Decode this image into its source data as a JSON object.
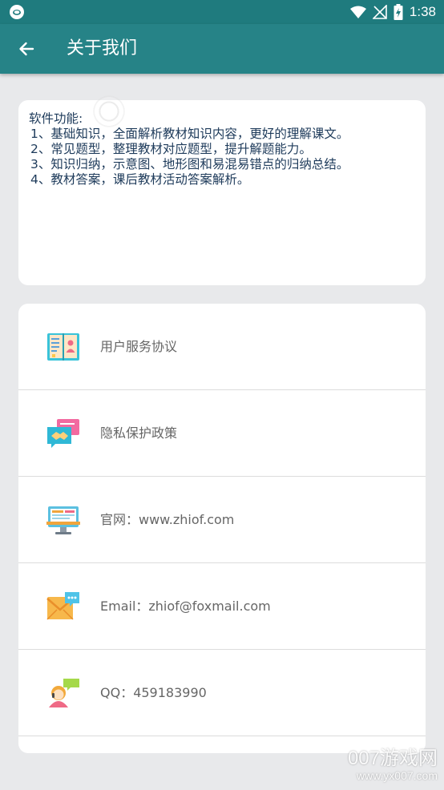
{
  "status_bar": {
    "time": "1:38",
    "icons": [
      "app-notification-icon",
      "wifi-icon",
      "signal-off-icon",
      "battery-charging-icon"
    ]
  },
  "app_bar": {
    "title": "关于我们",
    "back_icon": "arrow-left-icon"
  },
  "intro": {
    "heading": "软件功能:",
    "items": [
      "1、基础知识，全面解析教材知识内容，更好的理解课文。",
      "2、常见题型，整理教材对应题型，提升解题能力。",
      "3、知识归纳，示意图、地形图和易混易错点的归纳总结。",
      "4、教材答案，课后教材活动答案解析。"
    ]
  },
  "links": [
    {
      "label": "用户服务协议",
      "icon": "book-agreement-icon"
    },
    {
      "label": "隐私保护政策",
      "icon": "handshake-message-icon"
    },
    {
      "label": "官网：www.zhiof.com",
      "icon": "computer-website-icon"
    },
    {
      "label": "Email：zhiof@foxmail.com",
      "icon": "envelope-chat-icon"
    },
    {
      "label": "QQ：459183990",
      "icon": "person-chat-icon"
    }
  ],
  "watermark": {
    "main": "007游戏网",
    "url": "www.yx007.com"
  },
  "colors": {
    "status_bar": "#1f7b7e",
    "app_bar": "#268387",
    "background": "#e8e9eb",
    "intro_text": "#1d3a5a",
    "link_text": "#666666"
  }
}
